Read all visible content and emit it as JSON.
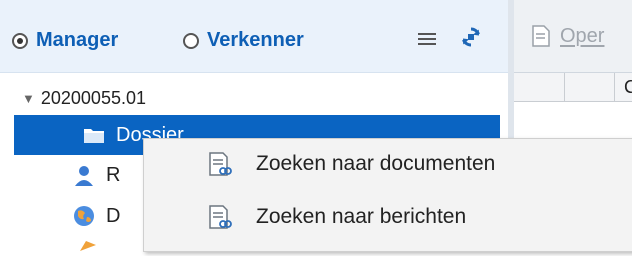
{
  "left_panel": {
    "mode_options": [
      {
        "label": "Manager",
        "selected": true
      },
      {
        "label": "Verkenner",
        "selected": false
      }
    ]
  },
  "tree": {
    "root_label": "20200055.01",
    "root_expanded": true,
    "children": [
      {
        "label": "Dossier",
        "icon": "folder-icon",
        "selected": true
      },
      {
        "label": "R",
        "icon": "person-icon",
        "selected": false
      },
      {
        "label": "D",
        "icon": "globe-icon",
        "selected": false
      }
    ]
  },
  "right_panel": {
    "open_button_label": "Oper",
    "grid_header_text": "C"
  },
  "context_menu": {
    "items": [
      {
        "label": "Zoeken naar documenten",
        "icon": "search-documents-icon"
      },
      {
        "label": "Zoeken naar berichten",
        "icon": "search-messages-icon"
      }
    ]
  },
  "colors": {
    "accent": "#0e5fb5",
    "selection": "#0a64c2",
    "topbar": "#eaf2fb"
  }
}
